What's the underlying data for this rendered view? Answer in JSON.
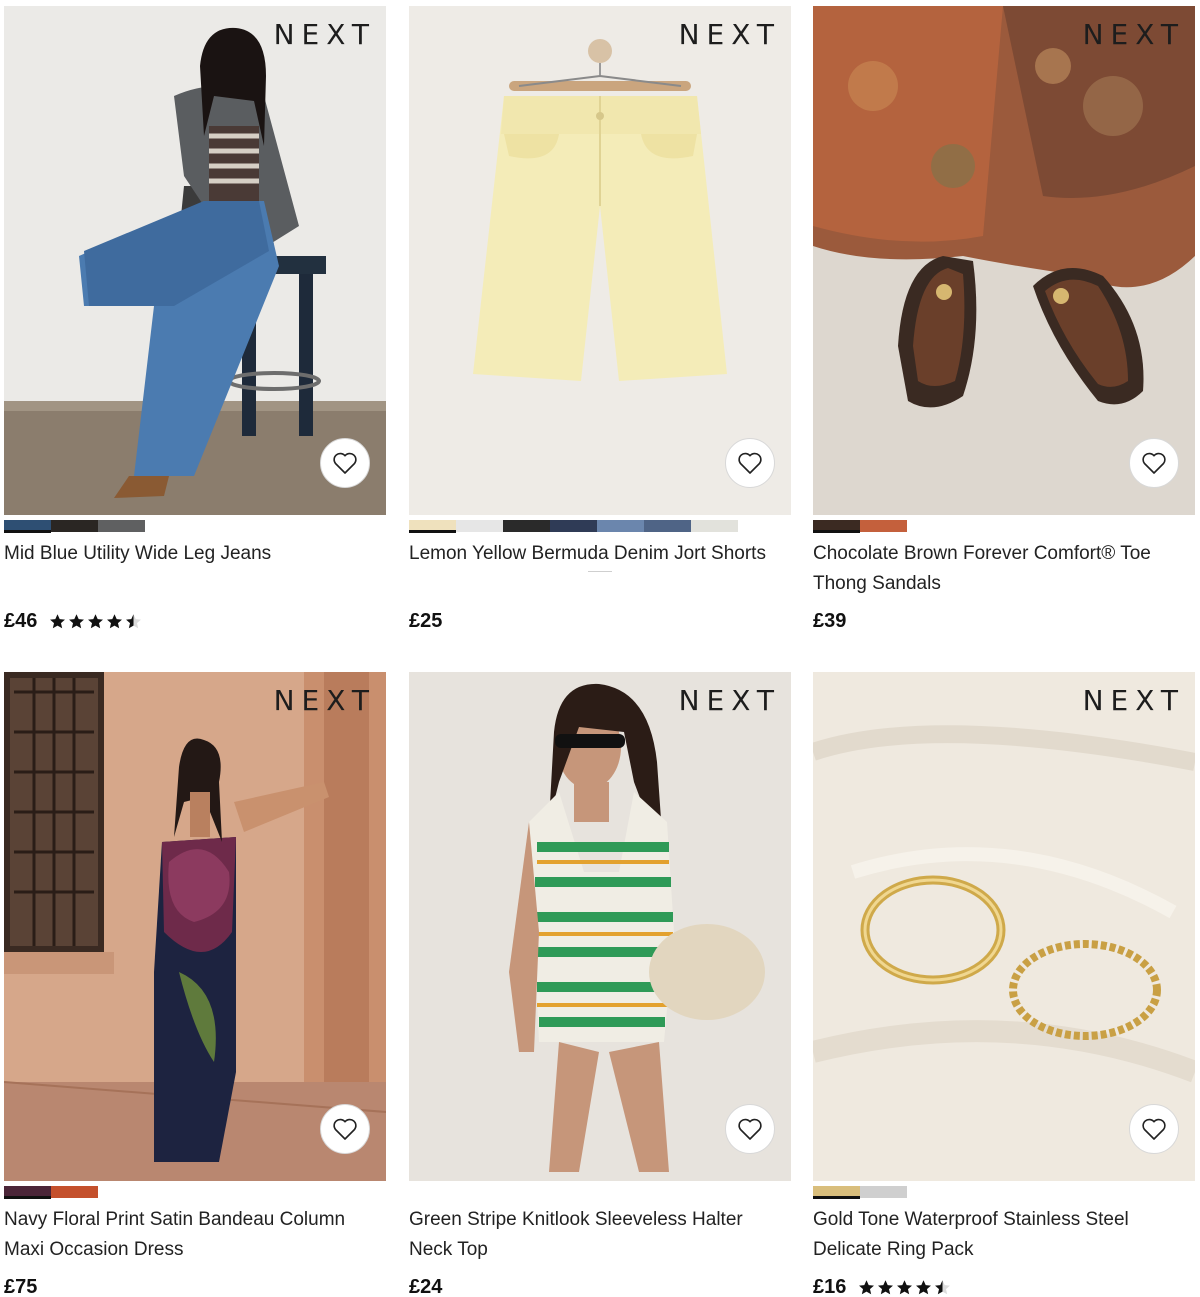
{
  "products": [
    {
      "brand_logo": "NEXT",
      "title": "Mid Blue Utility Wide Leg Jeans",
      "price": "£46",
      "rating": 4.5,
      "swatches": [
        "#2e4f73",
        "#2a2623",
        "#5f6061"
      ],
      "selected_swatch": 0,
      "image_desc_icon": "jeans-photo"
    },
    {
      "brand_logo": "NEXT",
      "title": "Lemon Yellow Bermuda Denim Jort Shorts",
      "price": "£25",
      "rating": null,
      "swatches": [
        "#efe1bd",
        "#e6e6e6",
        "#2a2a2a",
        "#2f3b56",
        "#6b86ad",
        "#4f6486",
        "#e2e2dc"
      ],
      "selected_swatch": 0,
      "image_desc_icon": "shorts-photo"
    },
    {
      "brand_logo": "NEXT",
      "title": "Chocolate Brown Forever Comfort® Toe Thong Sandals",
      "price": "£39",
      "rating": null,
      "swatches": [
        "#3b2a22",
        "#c4603c"
      ],
      "selected_swatch": 0,
      "image_desc_icon": "sandals-photo"
    },
    {
      "brand_logo": "NEXT",
      "title": "Navy Floral Print Satin Bandeau Column Maxi Occasion Dress",
      "price": "£75",
      "rating": null,
      "swatches": [
        "#4b2538",
        "#c4502c"
      ],
      "selected_swatch": 0,
      "image_desc_icon": "dress-photo"
    },
    {
      "brand_logo": "NEXT",
      "title": "Green Stripe Knitlook Sleeveless Halter Neck Top",
      "price": "£24",
      "rating": null,
      "swatches": [],
      "selected_swatch": null,
      "image_desc_icon": "halter-top-photo"
    },
    {
      "brand_logo": "NEXT",
      "title": "Gold Tone Waterproof Stainless Steel Delicate Ring Pack",
      "price": "£16",
      "rating": 4.5,
      "swatches": [
        "#d9be7c",
        "#cfcfcf"
      ],
      "selected_swatch": 0,
      "image_desc_icon": "ring-photo"
    }
  ],
  "wishlist_icon": "heart-icon",
  "colors": {
    "price": "#111111",
    "text": "#222222"
  }
}
